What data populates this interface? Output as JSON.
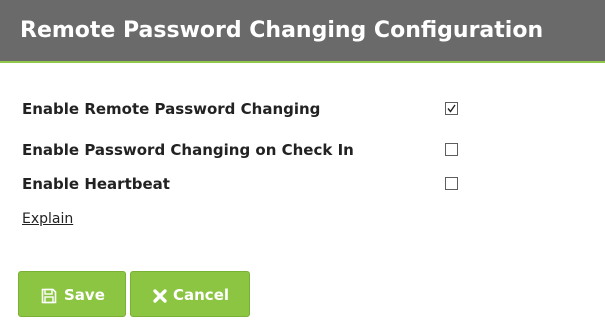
{
  "header": {
    "title": "Remote Password Changing Configuration"
  },
  "settings": [
    {
      "label": "Enable Remote Password Changing",
      "checked": true
    },
    {
      "label": "Enable Password Changing on Check In",
      "checked": false
    },
    {
      "label": "Enable Heartbeat",
      "checked": false
    }
  ],
  "explain_link": "Explain",
  "buttons": {
    "save_label": "Save",
    "save_icon": "floppy-disk-icon",
    "cancel_label": "Cancel",
    "cancel_icon": "x-icon"
  },
  "colors": {
    "header_bg": "#6a6a6a",
    "header_accent": "#92c84a",
    "button_bg": "#8bc542"
  }
}
